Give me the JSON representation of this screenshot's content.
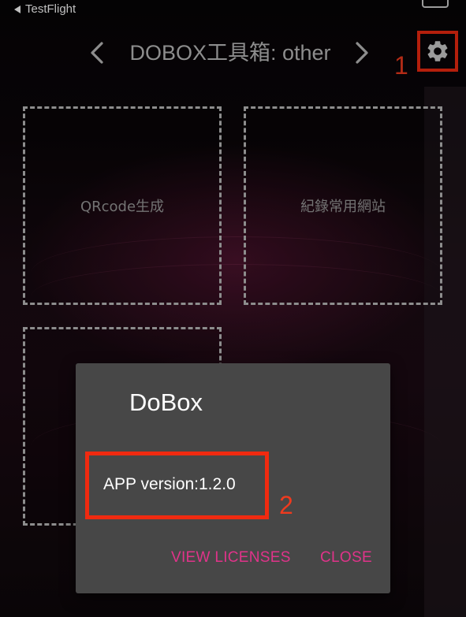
{
  "status_bar": {
    "back_app": "TestFlight"
  },
  "header": {
    "title": "DOBOX工具箱: other",
    "prev_icon": "chevron-left-icon",
    "next_icon": "chevron-right-icon",
    "settings_icon": "gear-icon"
  },
  "tools": [
    {
      "label": "QRcode生成"
    },
    {
      "label": "紀錄常用網站"
    },
    {
      "label": ""
    }
  ],
  "dialog": {
    "title": "DoBox",
    "version": "APP version:1.2.0",
    "view_licenses_label": "VIEW LICENSES",
    "close_label": "CLOSE"
  },
  "annotations": {
    "marker_1": "1",
    "marker_2": "2"
  },
  "colors": {
    "accent": "#e0338a",
    "annotation_red": "#f02a10",
    "dialog_bg": "#474747"
  }
}
